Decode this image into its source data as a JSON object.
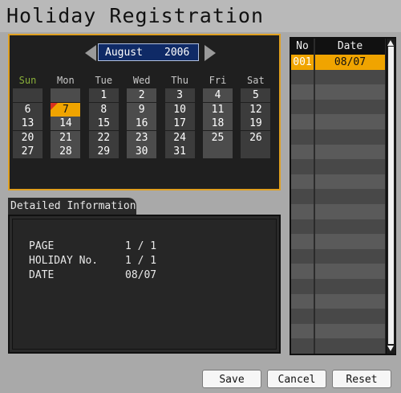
{
  "title": "Holiday Registration",
  "calendar": {
    "month": "August",
    "year": "2006",
    "weekdays": [
      "Sun",
      "Mon",
      "Tue",
      "Wed",
      "Thu",
      "Fri",
      "Sat"
    ],
    "days": [
      [
        "",
        "",
        "1",
        "2",
        "3",
        "4",
        "5"
      ],
      [
        "6",
        "7",
        "8",
        "9",
        "10",
        "11",
        "12"
      ],
      [
        "13",
        "14",
        "15",
        "16",
        "17",
        "18",
        "19"
      ],
      [
        "20",
        "21",
        "22",
        "23",
        "24",
        "25",
        "26"
      ],
      [
        "27",
        "28",
        "29",
        "30",
        "31",
        "",
        ""
      ]
    ],
    "selected_day": "7"
  },
  "detail": {
    "tab_label": "Detailed Information",
    "rows": [
      {
        "label": "PAGE",
        "value": "1 / 1"
      },
      {
        "label": "HOLIDAY No.",
        "value": "1 / 1"
      },
      {
        "label": "DATE",
        "value": "08/07"
      }
    ]
  },
  "holiday_list": {
    "header_no": "No",
    "header_date": "Date",
    "rows": [
      {
        "no": "001",
        "date": "08/07",
        "selected": true
      }
    ],
    "total_rows": 20
  },
  "buttons": {
    "save": "Save",
    "cancel": "Cancel",
    "reset": "Reset"
  },
  "colors": {
    "accent": "#f0a400",
    "sunday": "#8ab03a",
    "month_box": "#0f2a66",
    "panel_border": "#e0a020"
  }
}
